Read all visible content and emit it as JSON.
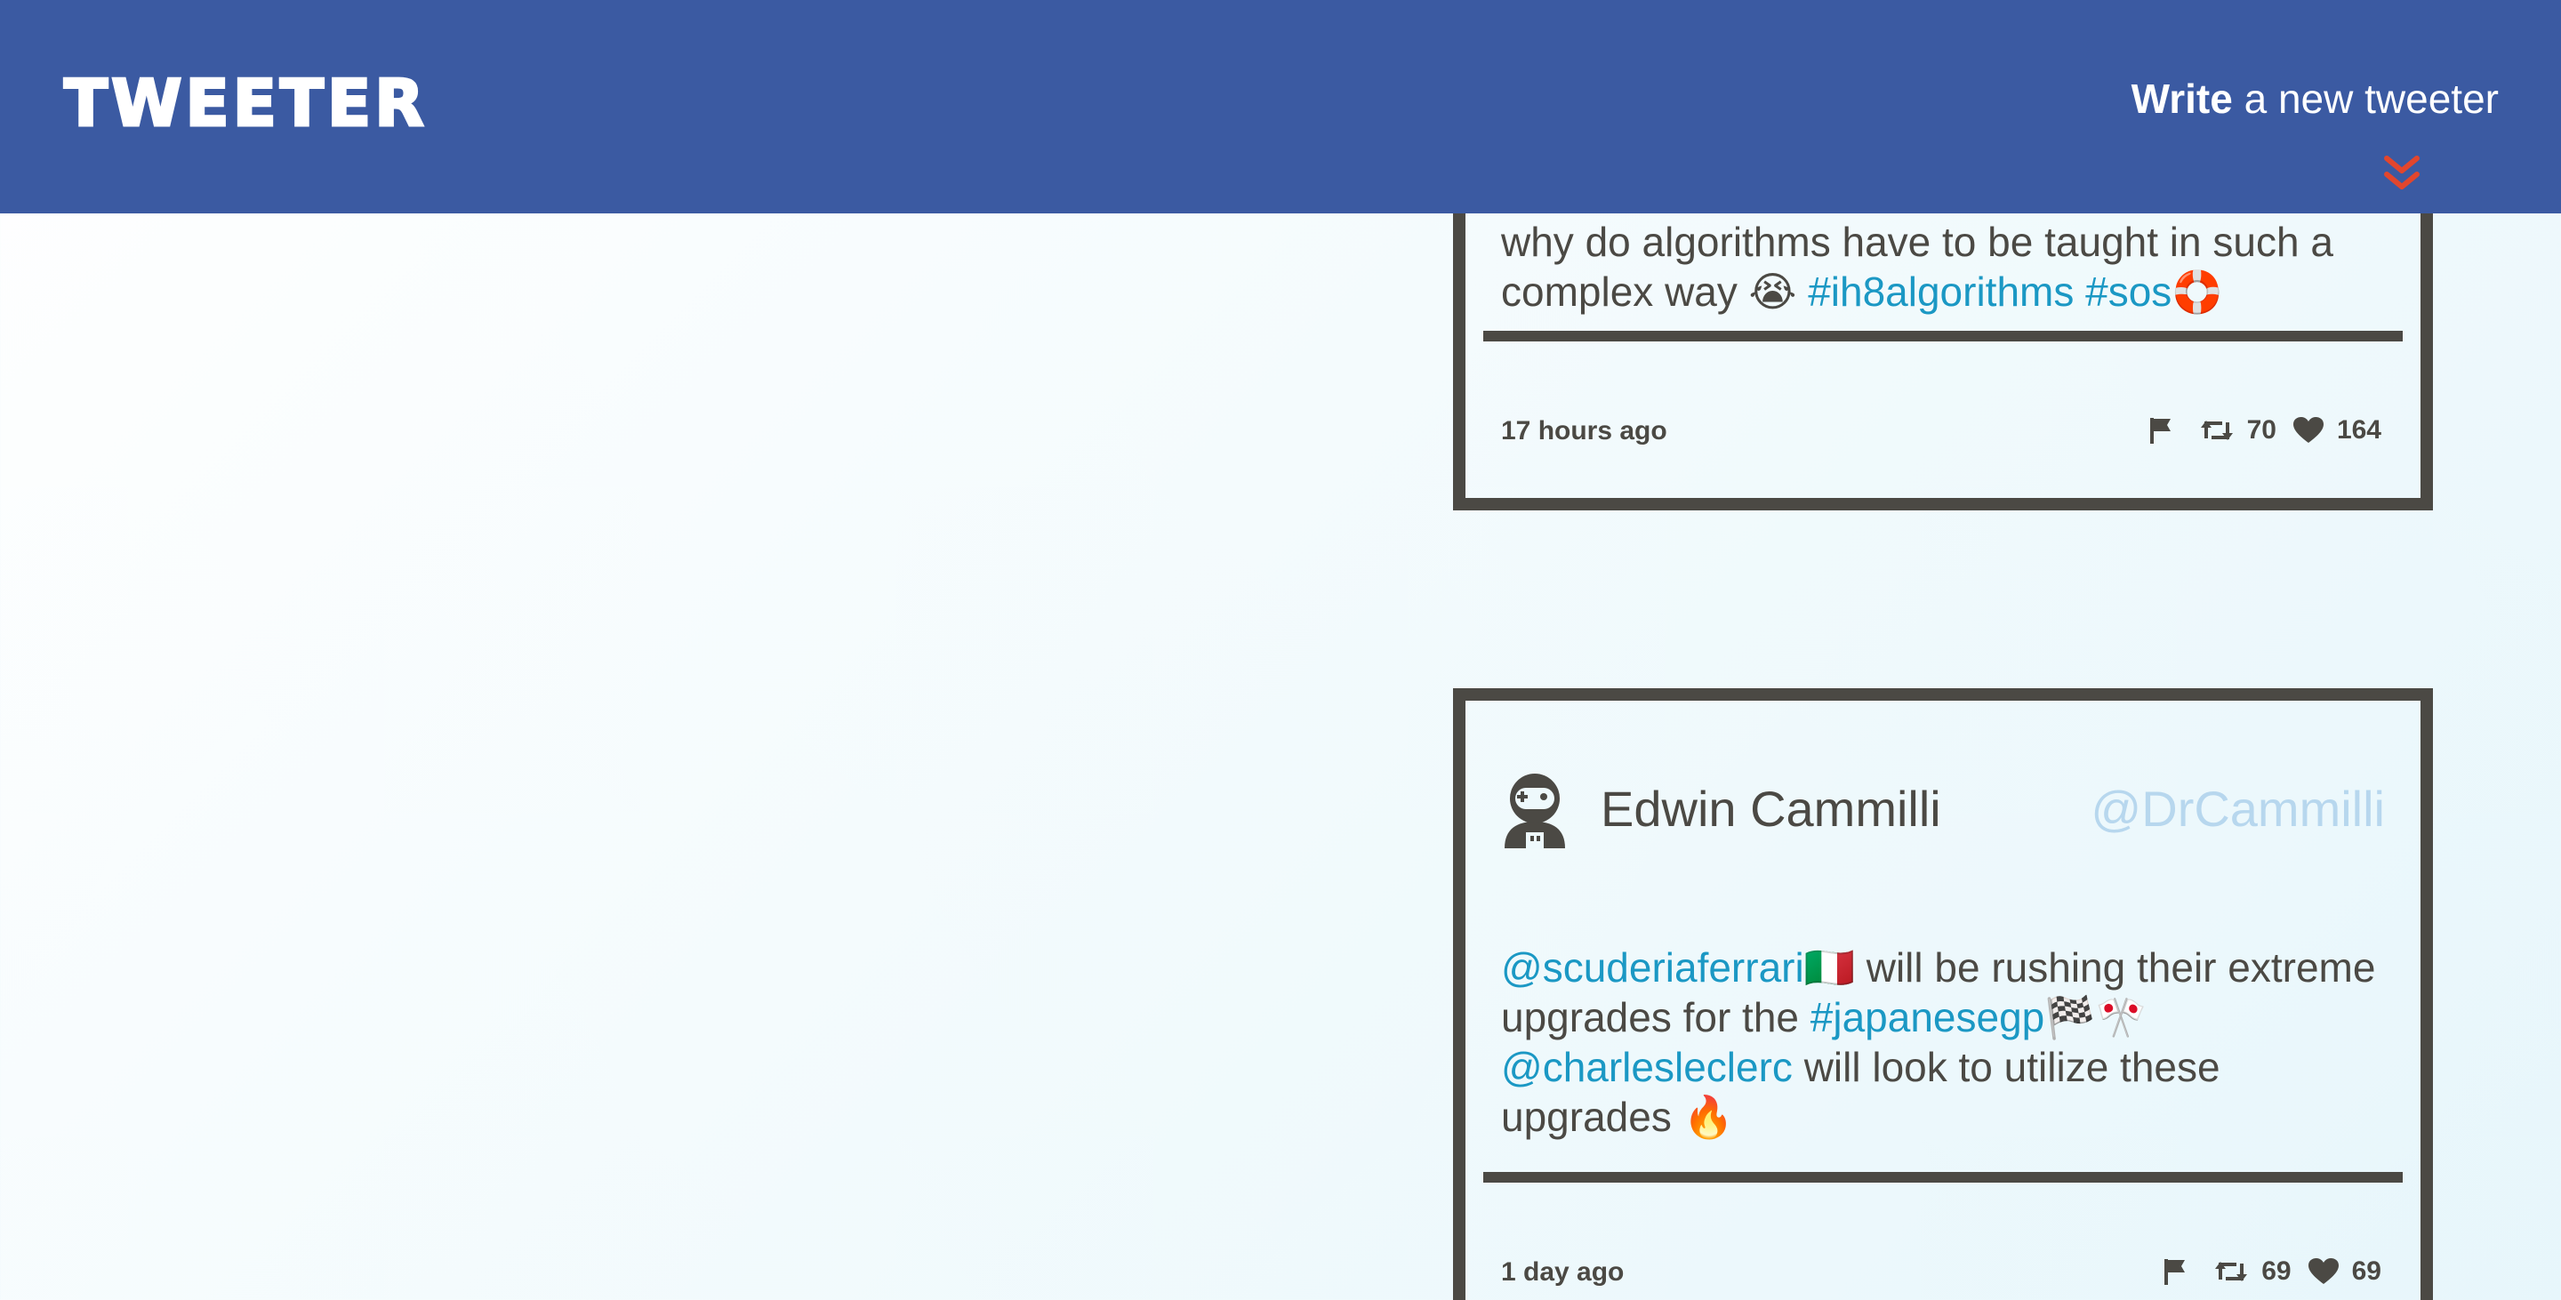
{
  "nav": {
    "brand": "TWEETER",
    "compose_strong": "Write",
    "compose_rest": " a new tweeter",
    "compose_icon": "double-chevron-down-icon",
    "colors": {
      "background": "#3b5aa2",
      "text": "#ffffff",
      "arrow": "#e2462d"
    }
  },
  "colors": {
    "text": "#4b4944",
    "link": "#1b98c4",
    "handle": "#b7d7ee",
    "border": "#4b4944"
  },
  "tweets": [
    {
      "body_segments": [
        {
          "text": "why do algorithms have to be taught in such a complex way 😭 ",
          "link": false
        },
        {
          "text": "#ih8algorithms",
          "link": true
        },
        {
          "text": " ",
          "link": false
        },
        {
          "text": "#sos",
          "link": true
        },
        {
          "text": "🛟",
          "link": false
        }
      ],
      "timestamp": "17 hours ago",
      "retweets": "70",
      "likes": "164"
    },
    {
      "name": "Edwin Cammilli",
      "handle": "@DrCammilli",
      "avatar_icon": "astronaut-avatar-icon",
      "body_segments": [
        {
          "text": "@scuderiaferrari",
          "link": true
        },
        {
          "text": "🇮🇹 will be rushing their extreme upgrades for the ",
          "link": false
        },
        {
          "text": "#japanesegp",
          "link": true
        },
        {
          "text": "🏁🎌 ",
          "link": false
        },
        {
          "text": "@charlesleclerc",
          "link": true
        },
        {
          "text": " will look to utilize these upgrades 🔥",
          "link": false
        }
      ],
      "timestamp": "1 day ago",
      "retweets": "69",
      "likes": "69"
    }
  ],
  "icons": {
    "flag": "flag-icon",
    "retweet": "retweet-icon",
    "like": "heart-icon"
  }
}
